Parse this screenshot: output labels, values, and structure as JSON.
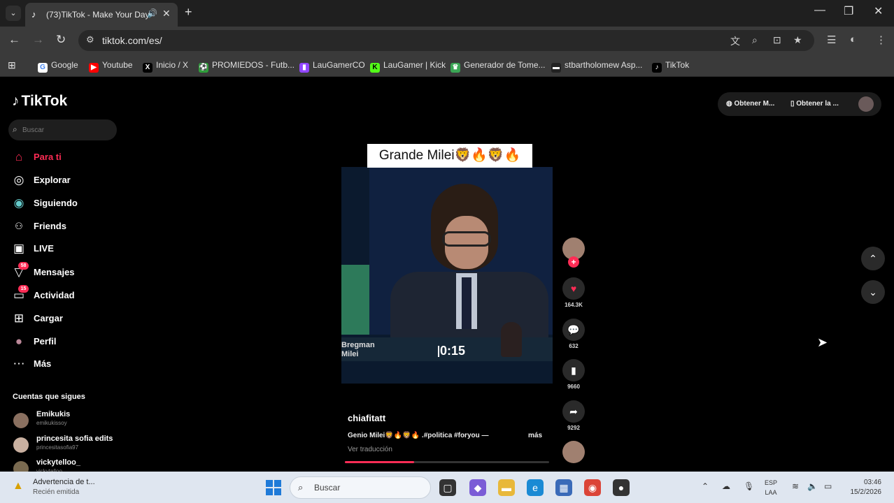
{
  "browser": {
    "tab_title": "(73)TikTok - Make Your Day",
    "url": "tiktok.com/es/",
    "bookmarks": [
      {
        "label": "Google",
        "color": "#4285f4",
        "glyph": "G"
      },
      {
        "label": "Youtube",
        "color": "#ff0000",
        "glyph": "▶"
      },
      {
        "label": "Inicio / X",
        "color": "#000000",
        "glyph": "X"
      },
      {
        "label": "PROMIEDOS - Futb...",
        "color": "#2e9e3a",
        "glyph": "⚽"
      },
      {
        "label": "LauGamerCO",
        "color": "#9146ff",
        "glyph": "▮"
      },
      {
        "label": "LauGamer | Kick",
        "color": "#53fc18",
        "glyph": "K"
      },
      {
        "label": "Generador de Tome...",
        "color": "#3aa655",
        "glyph": "🏆"
      },
      {
        "label": "stbartholomew Asp...",
        "color": "#222222",
        "glyph": "▬"
      },
      {
        "label": "TikTok",
        "color": "#000000",
        "glyph": "♪"
      }
    ]
  },
  "tiktok": {
    "logo": "TikTok",
    "search_placeholder": "Buscar",
    "nav": [
      {
        "label": "Para ti",
        "icon": "home-icon",
        "glyph": "⌂"
      },
      {
        "label": "Explorar",
        "icon": "compass-icon",
        "glyph": "◎"
      },
      {
        "label": "Siguiendo",
        "icon": "following-icon",
        "glyph": "◉"
      },
      {
        "label": "Friends",
        "icon": "friends-icon",
        "glyph": "👥"
      },
      {
        "label": "LIVE",
        "icon": "live-icon",
        "glyph": "▣"
      },
      {
        "label": "Mensajes",
        "icon": "messages-icon",
        "glyph": "▽",
        "badge": "58"
      },
      {
        "label": "Actividad",
        "icon": "activity-icon",
        "glyph": "▭",
        "badge": "15"
      },
      {
        "label": "Cargar",
        "icon": "upload-icon",
        "glyph": "⊞"
      },
      {
        "label": "Perfil",
        "icon": "profile-icon",
        "glyph": "●"
      },
      {
        "label": "Más",
        "icon": "more-icon",
        "glyph": "⋯"
      }
    ],
    "follows_title": "Cuentas que sigues",
    "accounts": [
      {
        "name": "Emikukis",
        "handle": "emikukissoy"
      },
      {
        "name": "princesita sofia edits",
        "handle": "princesitasofia97"
      },
      {
        "name": "vickytelloo_",
        "handle": "vickytelloo"
      }
    ],
    "top_buttons": [
      "Obtener M...",
      "Obtener la ..."
    ],
    "video": {
      "caption": "Grande Milei🦁🔥🦁🔥",
      "lower_third_names": [
        "Bregman",
        "Milei"
      ],
      "timer": "0:15",
      "author": "chiafitatt",
      "description": "Genio Milei🦁🔥🦁🔥 .#politica #foryou —",
      "more": "más",
      "translate": "Ver traducción",
      "progress": 0.34
    },
    "actions": {
      "likes": "164.3K",
      "comments": "632",
      "saves": "9660",
      "shares": "9292"
    }
  },
  "taskbar": {
    "notification_title": "Advertencia de t...",
    "notification_sub": "Recién emitida",
    "search": "Buscar",
    "lang_line1": "ESP",
    "lang_line2": "LAA",
    "time": "03:46",
    "date": "15/2/2026"
  }
}
